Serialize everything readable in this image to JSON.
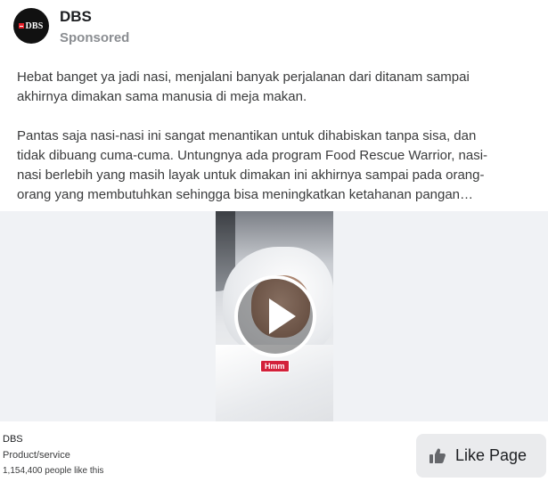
{
  "post": {
    "page_name": "DBS",
    "sponsored": "Sponsored",
    "avatar_text": "DBS",
    "text": "Hebat banget ya jadi nasi, menjalani banyak perjalanan dari ditanam sampai\nakhirnya dimakan sama manusia di meja makan.\n\nPantas saja nasi-nasi ini sangat menantikan untuk dihabiskan tanpa sisa, dan\ntidak dibuang cuma-cuma. Untungnya ada program Food Rescue Warrior, nasi-\nnasi berlebih yang masih layak untuk dimakan ini akhirnya sampai pada orang-\norang yang membutuhkan sehingga bisa meningkatkan ketahanan pangan…"
  },
  "video": {
    "caption_tag": "Hmm"
  },
  "footer": {
    "name": "DBS",
    "category": "Product/service",
    "likes": "1,154,400 people like this",
    "like_button": "Like Page"
  },
  "colors": {
    "brand_red": "#e8202a",
    "tag_red": "#d3213a",
    "button_bg": "#eaebed"
  },
  "icons": {
    "avatar": "dbs-logo-icon",
    "play": "play-icon",
    "like": "thumbs-up-icon"
  }
}
